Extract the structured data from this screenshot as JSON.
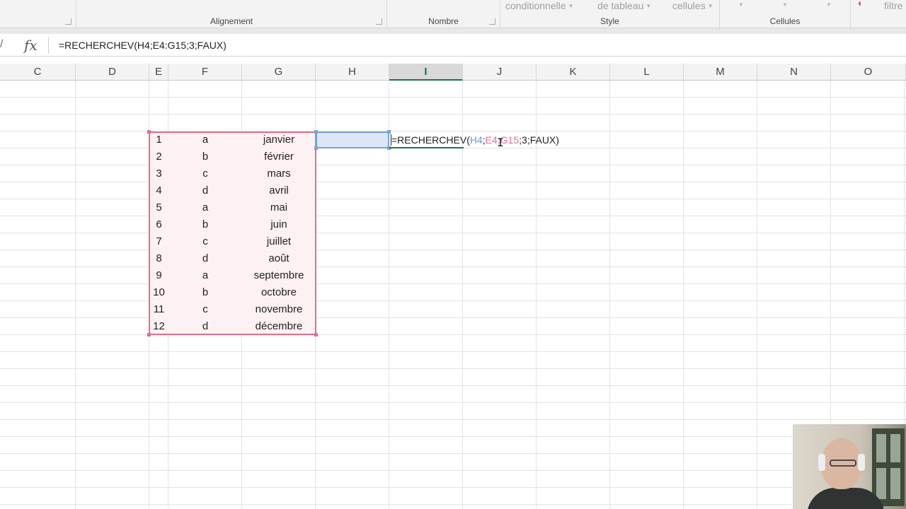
{
  "ribbon": {
    "groups": [
      {
        "label": "Alignement"
      },
      {
        "label": "Nombre"
      },
      {
        "label": "Style"
      },
      {
        "label": "Cellules"
      }
    ],
    "style_buttons": [
      "conditionnelle",
      "de tableau",
      "cellules"
    ],
    "right_button": "filtre"
  },
  "formula_bar": {
    "fx_label": "fx",
    "formula": "=RECHERCHEV(H4;E4:G15;3;FAUX)"
  },
  "columns": [
    "C",
    "D",
    "E",
    "F",
    "G",
    "H",
    "I",
    "J",
    "K",
    "L",
    "M",
    "N",
    "O"
  ],
  "active_column": "I",
  "table": {
    "rows": [
      {
        "num": "1",
        "letter": "a",
        "month": "janvier"
      },
      {
        "num": "2",
        "letter": "b",
        "month": "février"
      },
      {
        "num": "3",
        "letter": "c",
        "month": "mars"
      },
      {
        "num": "4",
        "letter": "d",
        "month": "avril"
      },
      {
        "num": "5",
        "letter": "a",
        "month": "mai"
      },
      {
        "num": "6",
        "letter": "b",
        "month": "juin"
      },
      {
        "num": "7",
        "letter": "c",
        "month": "juillet"
      },
      {
        "num": "8",
        "letter": "d",
        "month": "août"
      },
      {
        "num": "9",
        "letter": "a",
        "month": "septembre"
      },
      {
        "num": "10",
        "letter": "b",
        "month": "octobre"
      },
      {
        "num": "11",
        "letter": "c",
        "month": "novembre"
      },
      {
        "num": "12",
        "letter": "d",
        "month": "décembre"
      }
    ]
  },
  "cell_edit": {
    "prefix": "=RECHERCHEV(",
    "ref1": "H4",
    "sep1": ";",
    "ref2": "E4:G15",
    "suffix": ";3;FAUX)"
  },
  "colors": {
    "accent_green": "#217346",
    "range_red": "#e0708a",
    "range_blue": "#7aa3d6"
  }
}
